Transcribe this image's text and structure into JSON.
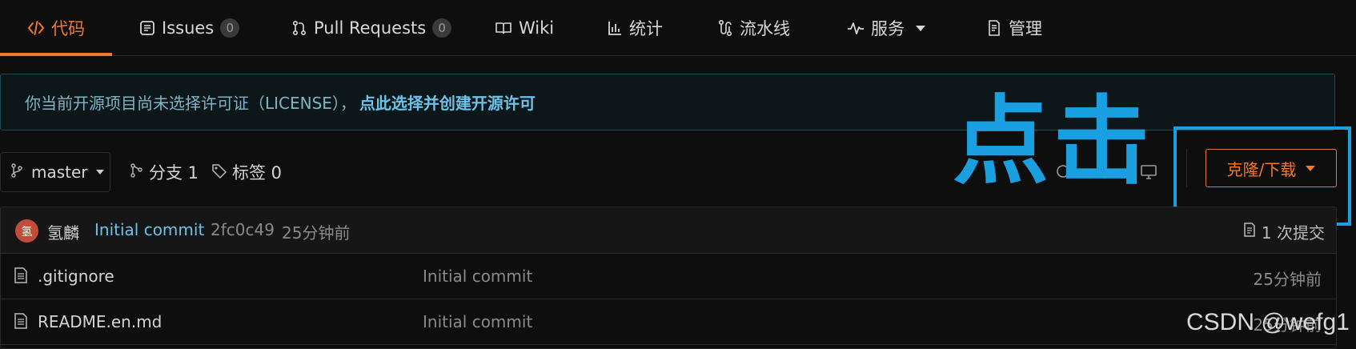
{
  "tabs": [
    {
      "label": "代码",
      "icon": "code-icon",
      "active": true
    },
    {
      "label": "Issues",
      "badge": "0",
      "icon": "issues-icon"
    },
    {
      "label": "Pull Requests",
      "badge": "0",
      "icon": "pull-request-icon"
    },
    {
      "label": "Wiki",
      "icon": "book-icon"
    },
    {
      "label": "统计",
      "icon": "bar-chart-icon"
    },
    {
      "label": "流水线",
      "icon": "pipeline-icon"
    },
    {
      "label": "服务",
      "icon": "pulse-icon"
    },
    {
      "label": "管理",
      "icon": "settings-doc-icon"
    }
  ],
  "license": {
    "text": "你当前开源项目尚未选择许可证（LICENSE），",
    "link": "点此选择并创建开源许可"
  },
  "repo_bar": {
    "branch": "master",
    "branches_label": "分支 1",
    "tags_label": "标签 0",
    "clone_label": "克隆/下载"
  },
  "annotation": {
    "text": "点击",
    "color": "#1aa0e0"
  },
  "commit": {
    "avatar_char": "氢",
    "author": "氢麟",
    "message": "Initial commit",
    "sha": "2fc0c49",
    "time": "25分钟前",
    "count_label": "1 次提交"
  },
  "files": [
    {
      "name": ".gitignore",
      "message": "Initial commit",
      "time": "25分钟前"
    },
    {
      "name": "README.en.md",
      "message": "Initial commit",
      "time": "25分钟前"
    }
  ],
  "watermark": "CSDN @wefg1",
  "colors": {
    "accent": "#f07a2a",
    "link": "#6cc3ea",
    "background": "#0e0e0e"
  }
}
